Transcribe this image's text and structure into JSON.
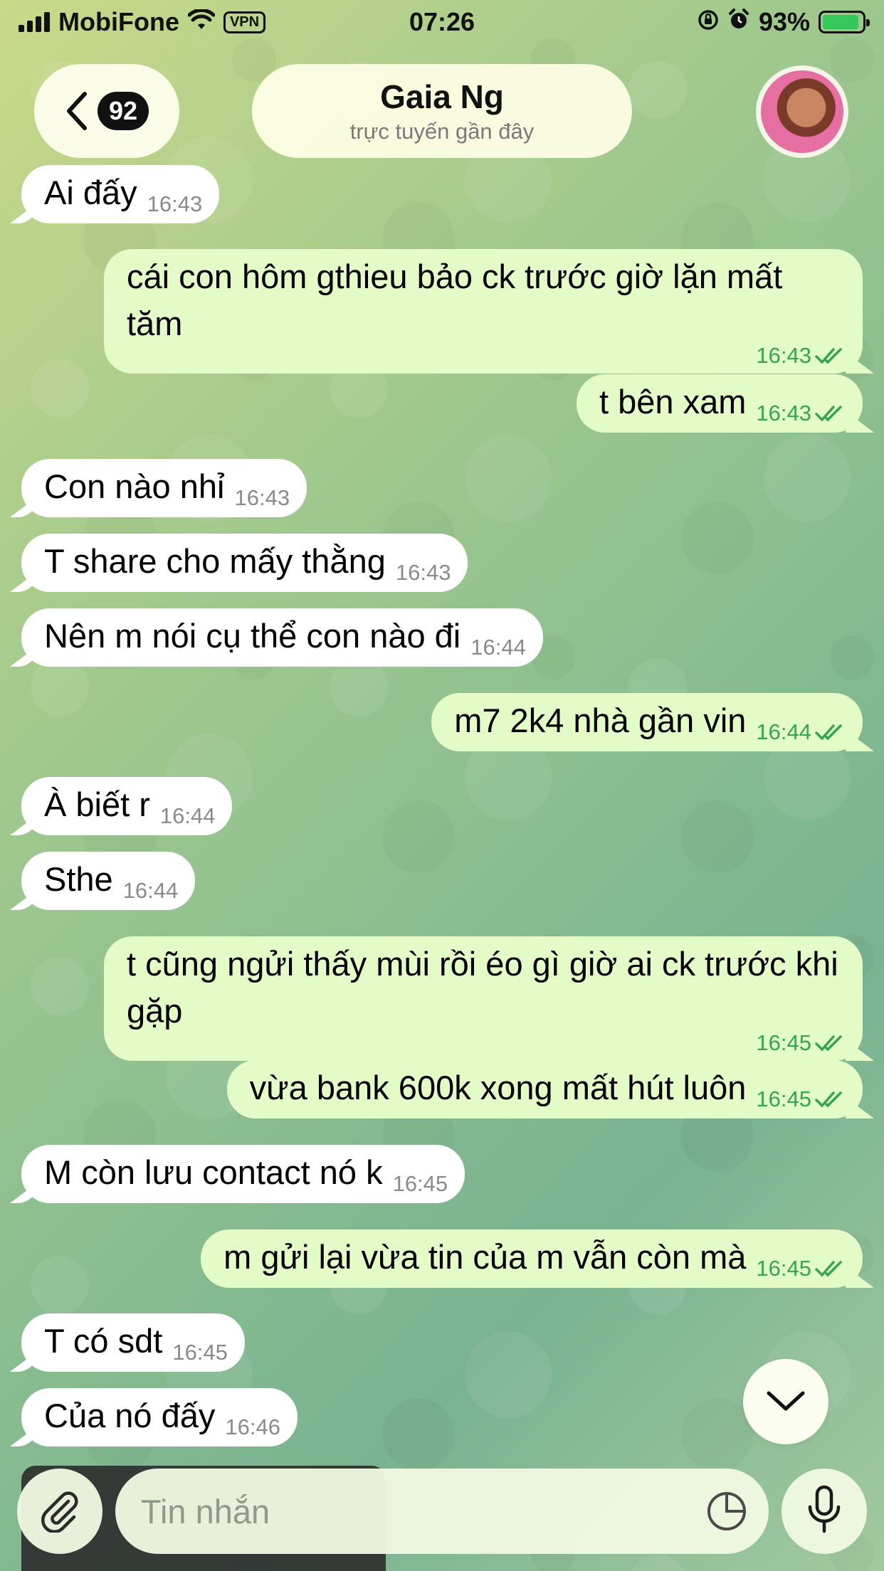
{
  "status_bar": {
    "carrier": "MobiFone",
    "vpn": "VPN",
    "time": "07:26",
    "battery_percent": "93%",
    "battery_level": 0.93,
    "icons": [
      "signal-icon",
      "wifi-icon",
      "vpn-icon",
      "rotation-lock-icon",
      "alarm-icon",
      "battery-charging-icon"
    ]
  },
  "header": {
    "unread_count": "92",
    "contact_name": "Gaia Ng",
    "contact_status": "trực tuyến gần đây"
  },
  "messages": [
    {
      "dir": "in",
      "text": "Ai đấy",
      "time": "16:43"
    },
    {
      "dir": "out",
      "text": "cái con hôm gthieu bảo ck trước giờ lặn mất tăm",
      "time": "16:43",
      "read": true
    },
    {
      "dir": "out",
      "text": "t bên xam",
      "time": "16:43",
      "read": true
    },
    {
      "dir": "in",
      "text": "Con nào nhỉ",
      "time": "16:43"
    },
    {
      "dir": "in",
      "text": "T share cho mấy thằng",
      "time": "16:43"
    },
    {
      "dir": "in",
      "text": "Nên m nói cụ thể con nào đi",
      "time": "16:44"
    },
    {
      "dir": "out",
      "text": "m7 2k4 nhà gần vin",
      "time": "16:44",
      "read": true
    },
    {
      "dir": "in",
      "text": "À biết r",
      "time": "16:44"
    },
    {
      "dir": "in",
      "text": "Sthe",
      "time": "16:44"
    },
    {
      "dir": "out",
      "text": "t cũng ngửi thấy mùi rồi éo gì giờ ai ck trước khi gặp",
      "time": "16:45",
      "read": true
    },
    {
      "dir": "out",
      "text": "vừa bank 600k xong mất hút luôn",
      "time": "16:45",
      "read": true
    },
    {
      "dir": "in",
      "text": "M còn lưu contact nó k",
      "time": "16:45"
    },
    {
      "dir": "out",
      "text": "m gửi lại vừa tin của m vẫn còn mà",
      "time": "16:45",
      "read": true
    },
    {
      "dir": "in",
      "text": "T có sdt",
      "time": "16:45"
    },
    {
      "dir": "in",
      "text": "Của nó đấy",
      "time": "16:46"
    }
  ],
  "composer": {
    "placeholder": "Tin nhắn"
  },
  "colors": {
    "incoming_bubble": "#ffffff",
    "outgoing_bubble": "#e3fbc7",
    "outgoing_meta": "#37a44f",
    "incoming_meta": "#8a8a8a"
  }
}
